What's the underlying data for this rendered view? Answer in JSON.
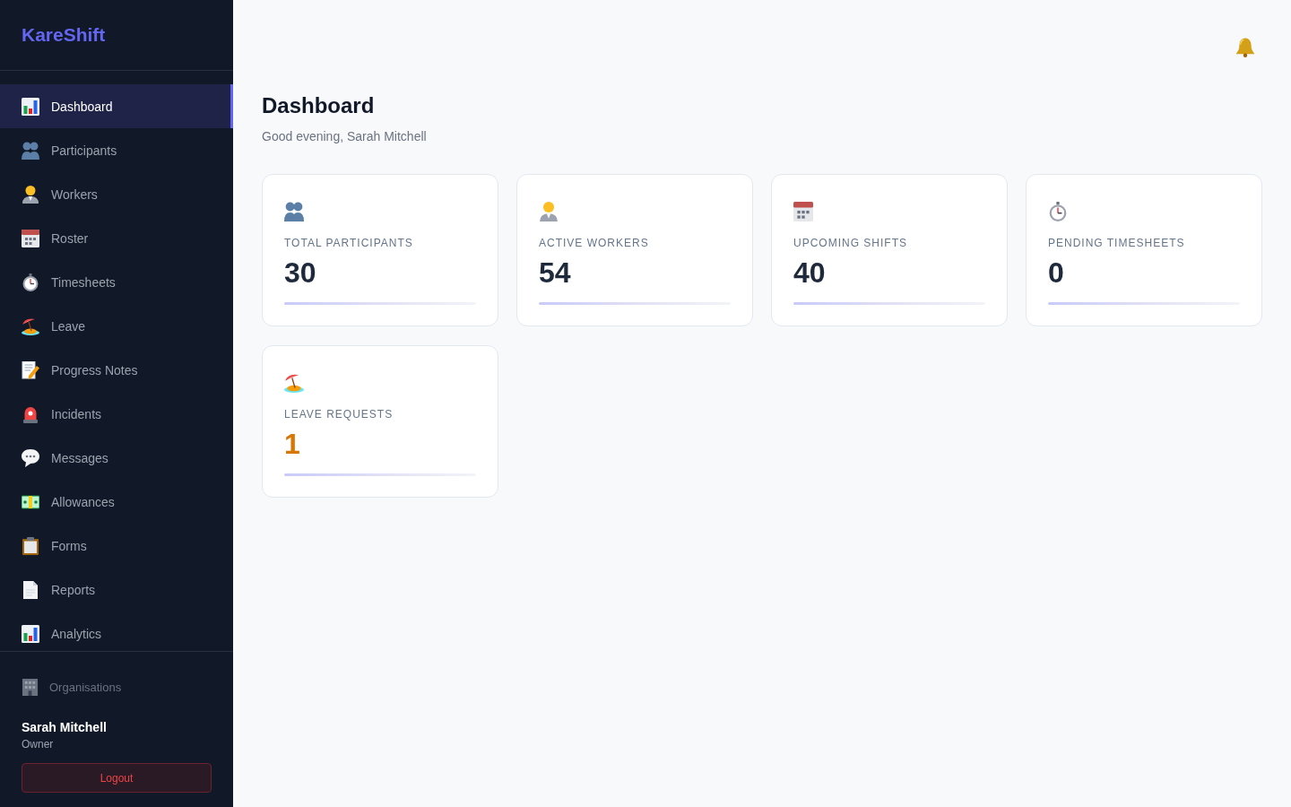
{
  "sidebar": {
    "logo": "KareShift",
    "nav_items": [
      {
        "label": "Dashboard",
        "selected": true
      },
      {
        "label": "Participants",
        "selected": false
      },
      {
        "label": "Workers",
        "selected": false
      },
      {
        "label": "Roster",
        "selected": false
      },
      {
        "label": "Timesheets",
        "selected": false
      },
      {
        "label": "Leave",
        "selected": false
      },
      {
        "label": "Progress Notes",
        "selected": false
      },
      {
        "label": "Incidents",
        "selected": false
      },
      {
        "label": "Messages",
        "selected": false
      },
      {
        "label": "Allowances",
        "selected": false
      },
      {
        "label": "Forms",
        "selected": false
      },
      {
        "label": "Reports",
        "selected": false
      },
      {
        "label": "Analytics",
        "selected": false
      }
    ],
    "organisations_link": "Organisations",
    "user": {
      "name": "Sarah Mitchell",
      "role": "Owner"
    },
    "logout_button": "Logout"
  },
  "header": {
    "title": "Dashboard",
    "greeting": "Good evening, Sarah Mitchell"
  },
  "stats": [
    {
      "label": "TOTAL PARTICIPANTS",
      "value": "30",
      "color": "#1e293b"
    },
    {
      "label": "ACTIVE WORKERS",
      "value": "54",
      "color": "#1e293b"
    },
    {
      "label": "UPCOMING SHIFTS",
      "value": "40",
      "color": "#1e293b"
    },
    {
      "label": "PENDING TIMESHEETS",
      "value": "0",
      "color": "#1e293b"
    },
    {
      "label": "LEAVE REQUESTS",
      "value": "1",
      "color": "#d97706"
    }
  ]
}
